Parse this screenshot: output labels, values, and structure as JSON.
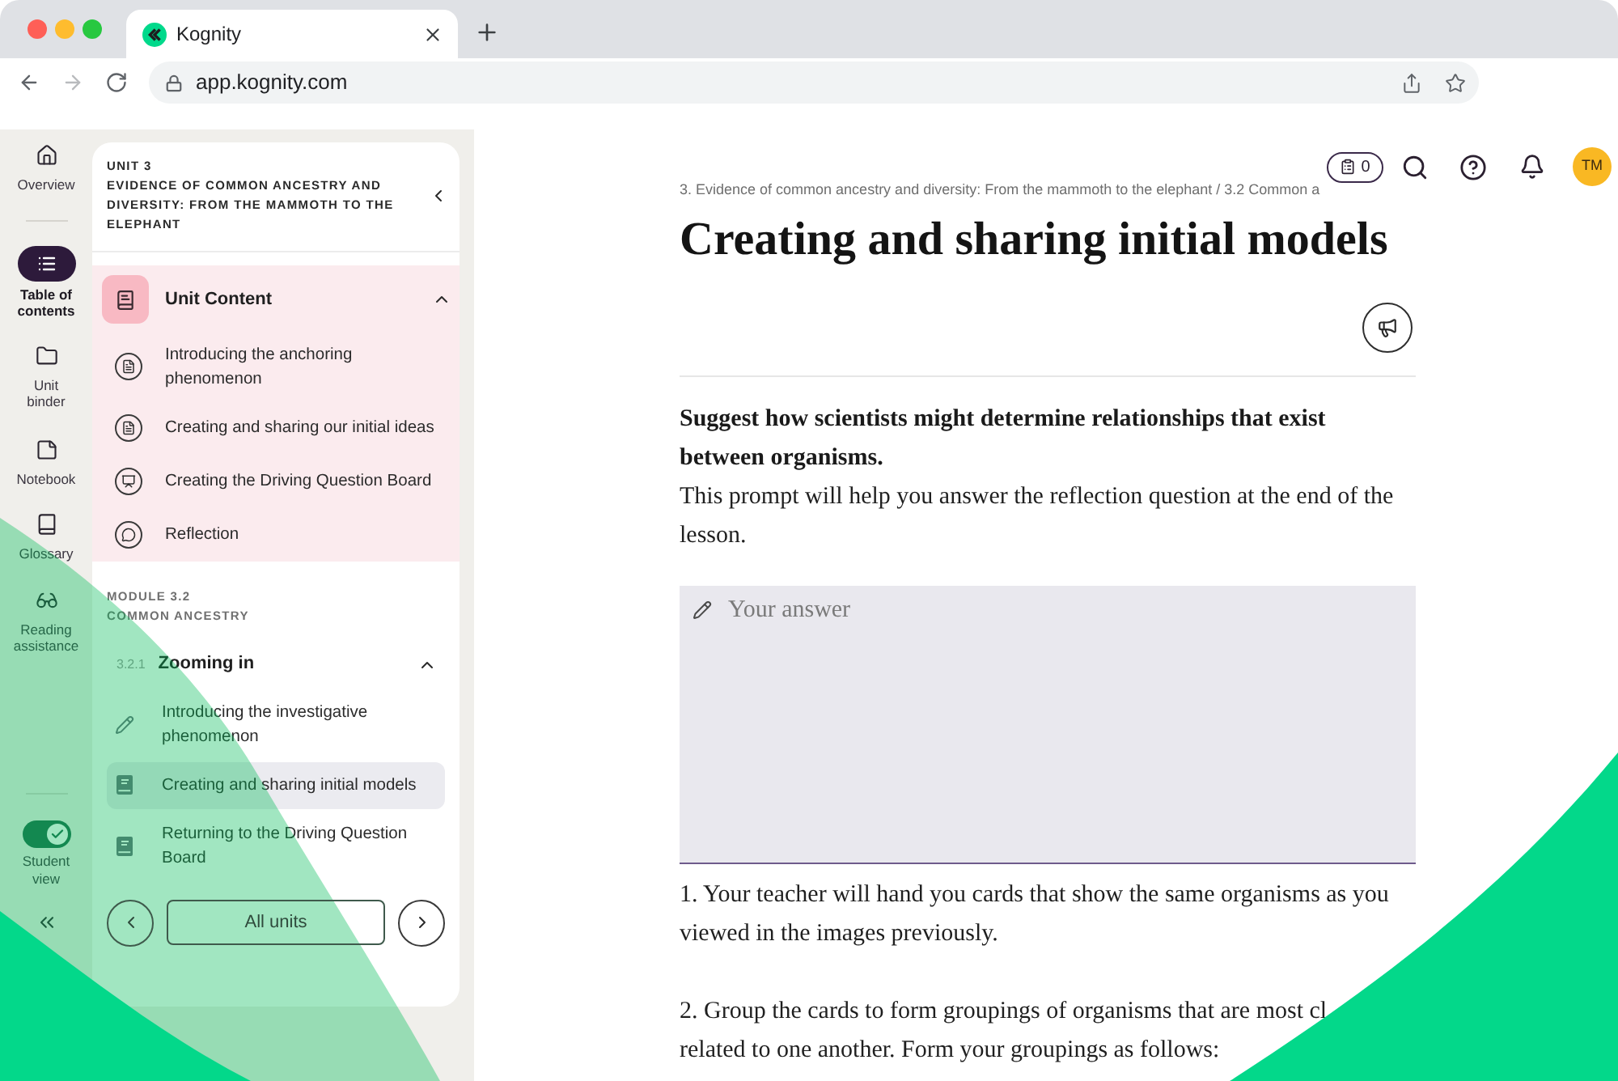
{
  "browser": {
    "tab_title": "Kognity",
    "url": "app.kognity.com"
  },
  "nav_rail": {
    "items": [
      {
        "label": "Overview",
        "selected": false
      },
      {
        "label": "Table of contents",
        "selected": true
      },
      {
        "label": "Unit binder",
        "selected": false
      },
      {
        "label": "Notebook",
        "selected": false
      },
      {
        "label": "Glossary",
        "selected": false
      },
      {
        "label": "Reading assistance",
        "selected": false
      }
    ],
    "student_view": {
      "label": "Student view",
      "on": true
    }
  },
  "sidebar": {
    "unit": {
      "label": "UNIT 3",
      "title": "EVIDENCE OF COMMON ANCESTRY AND DIVERSITY: FROM THE MAMMOTH TO THE ELEPHANT"
    },
    "unit_content": {
      "title": "Unit Content",
      "expanded": true,
      "items": [
        {
          "title": "Introducing the anchoring phenomenon",
          "kind": "reading",
          "selected": false
        },
        {
          "title": "Creating and sharing our initial ideas",
          "kind": "reading",
          "selected": false
        },
        {
          "title": "Creating the Driving Question Board",
          "kind": "board",
          "selected": false
        },
        {
          "title": "Reflection",
          "kind": "reflection",
          "selected": false
        }
      ]
    },
    "module": {
      "label": "MODULE 3.2",
      "title": "COMMON ANCESTRY",
      "subtopic": {
        "number": "3.2.1",
        "title": "Zooming in",
        "expanded": true,
        "items": [
          {
            "title": "Introducing the investigative phenomenon",
            "kind": "exercise",
            "selected": false
          },
          {
            "title": "Creating and sharing initial models",
            "kind": "reading",
            "selected": true
          },
          {
            "title": "Returning to the Driving Question Board",
            "kind": "reading",
            "selected": false
          }
        ]
      }
    },
    "all_units_button": "All units"
  },
  "toolbar": {
    "task_count": "0",
    "avatar_initials": "TM"
  },
  "page": {
    "breadcrumb": "3. Evidence of common ancestry and diversity: From the mammoth to the elephant / 3.2 Common a",
    "title": "Creating and sharing initial models",
    "prompt": "Suggest how scientists might determine relationships that exist between organisms.",
    "prompt_note": "This prompt will help you answer the reflection question at the end of the lesson.",
    "answer": {
      "placeholder": "Your answer"
    },
    "paragraphs": [
      {
        "lines": [
          "1. Your teacher will hand you cards that show the same organisms as you viewed in the images previously."
        ]
      },
      {
        "lines": [
          "2. Group the cards to form groupings of organisms that are most cl",
          "related to one another. Form your groupings as follows:"
        ]
      }
    ]
  }
}
